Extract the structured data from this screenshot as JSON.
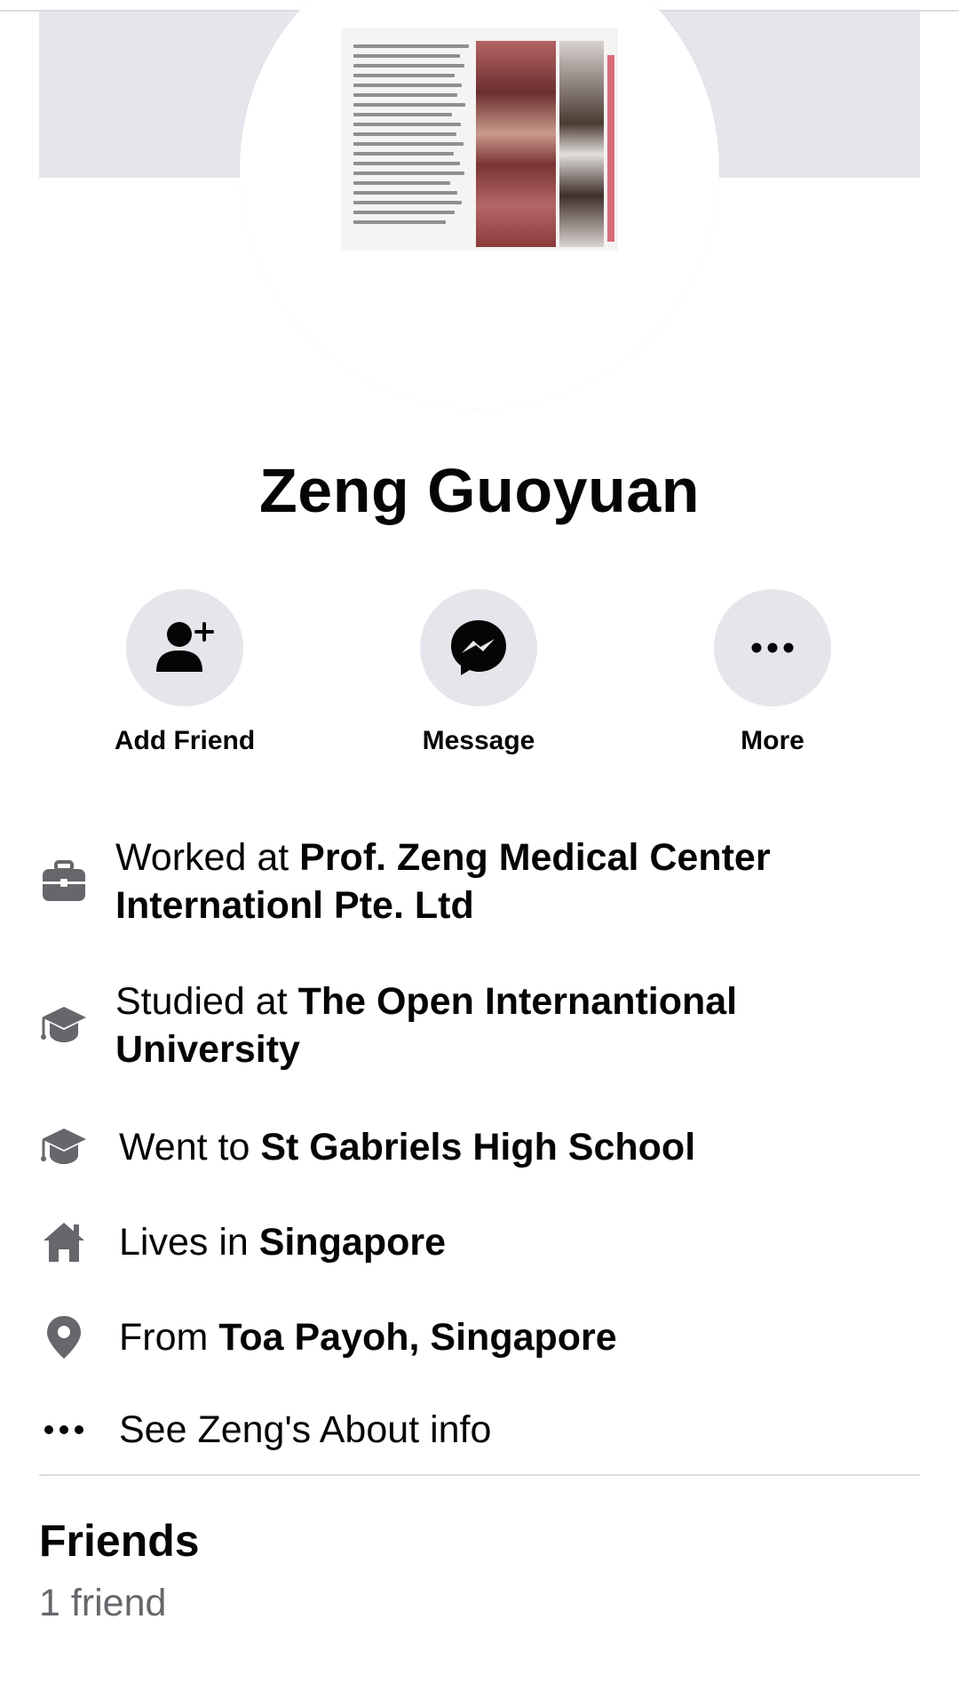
{
  "profile": {
    "name": "Zeng Guoyuan"
  },
  "actions": {
    "add_friend": {
      "label": "Add Friend",
      "icon": "add-person-icon"
    },
    "message": {
      "label": "Message",
      "icon": "messenger-icon"
    },
    "more": {
      "label": "More",
      "icon": "more-dots-icon"
    }
  },
  "intro": {
    "work": {
      "prefix": "Worked at ",
      "value": "Prof. Zeng Medical Center Internationl Pte. Ltd",
      "icon": "briefcase-icon"
    },
    "college": {
      "prefix": "Studied at ",
      "value": "The Open Internantional University",
      "icon": "graduation-cap-icon"
    },
    "highschool": {
      "prefix": "Went to ",
      "value": "St Gabriels High School",
      "icon": "graduation-cap-icon"
    },
    "lives": {
      "prefix": "Lives in ",
      "value": "Singapore",
      "icon": "home-icon"
    },
    "from": {
      "prefix": "From ",
      "value": "Toa Payoh, Singapore",
      "icon": "location-pin-icon"
    },
    "about_link": {
      "label": "See Zeng's About info",
      "icon": "more-dots-icon"
    }
  },
  "friends": {
    "title": "Friends",
    "count": "1 friend"
  },
  "colors": {
    "button_bg": "#e4e6eb",
    "icon_gray": "#65676b",
    "text": "#050505",
    "secondary_text": "#65676b"
  }
}
